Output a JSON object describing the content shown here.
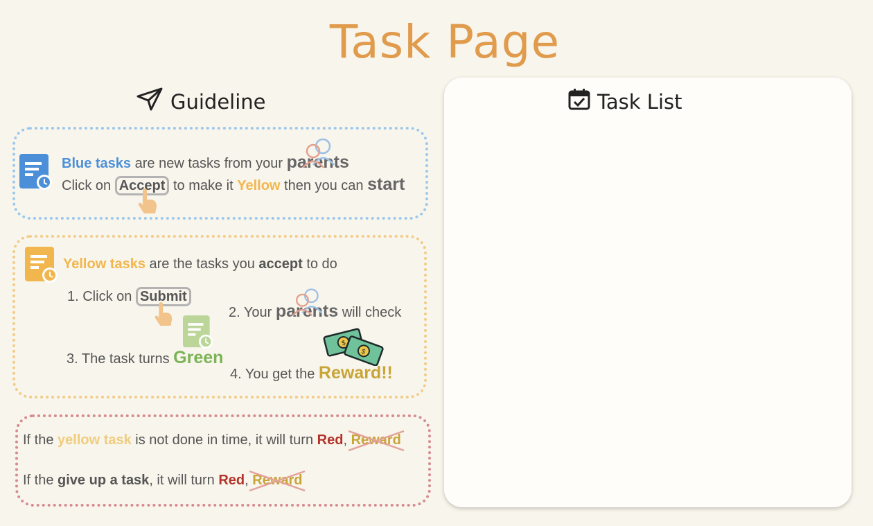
{
  "page": {
    "title": "Task Page"
  },
  "guideline": {
    "heading": "Guideline",
    "heading_icon": "send-icon",
    "blue": {
      "l1_b1": "Blue tasks",
      "l1_t1": " are new tasks from your ",
      "l1_b2": "parents",
      "l2_t1": "Click on ",
      "l2_pill": "Accept",
      "l2_t2": " to make it ",
      "l2_b1": "Yellow",
      "l2_t3": " then you can ",
      "l2_b2": "start"
    },
    "yellow": {
      "l1_b1": "Yellow tasks",
      "l1_t1": " are the tasks you ",
      "l1_b2": "accept",
      "l1_t2": " to do",
      "s1_t": "1. Click on ",
      "s1_pill": "Submit",
      "s2_t1": "2. Your ",
      "s2_b": "parents",
      "s2_t2": " will check",
      "s3_t": "3. The task turns ",
      "s3_b": "Green",
      "s4_t": "4. You get the ",
      "s4_b": "Reward!!"
    },
    "red": {
      "l1_t1": "If the ",
      "l1_b1": "yellow task",
      "l1_t2": " is not done in time, it will turn ",
      "l1_b2": "Red",
      "l1_t3": ", ",
      "l1_b3": "Reward",
      "l2_t1": "If the ",
      "l2_b1": "give up a task",
      "l2_t2": ",  it will turn ",
      "l2_b2": "Red",
      "l2_t3": ", ",
      "l2_b3": "Reward"
    }
  },
  "task_list": {
    "heading": "Task List",
    "heading_icon": "calendar-check-icon"
  },
  "colors": {
    "title": "#e09b4c",
    "blue": "#4b8fd8",
    "yellow": "#f2b64e",
    "green": "#7bb355",
    "gold": "#c9a437",
    "red": "#b3332a"
  }
}
